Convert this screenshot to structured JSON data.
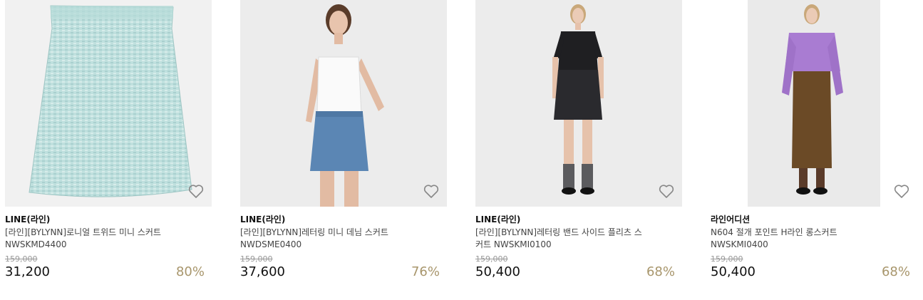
{
  "products": [
    {
      "brand": "LINE(라인)",
      "name": "[라인][BYLYNN]로니얼 트위드 미니 스커트 NWSKMD4400",
      "original_price": "159,000",
      "price": "31,200",
      "discount": "80%",
      "image": "light-mint-tweed-mini-skirt",
      "colors": {
        "bg": "#f1f1f1",
        "garment": "#bfe0de"
      }
    },
    {
      "brand": "LINE(라인)",
      "name": "[라인][BYLYNN]레터링 미니 데님 스커트 NWDSME0400",
      "original_price": "159,000",
      "price": "37,600",
      "discount": "76%",
      "image": "model-white-tank-denim-mini-skirt",
      "colors": {
        "bg": "#ececec",
        "garment": "#5b86b4"
      }
    },
    {
      "brand": "LINE(라인)",
      "name": "[라인][BYLYNN]레터링 밴드 사이드 플리츠 스커트 NWSKMI0100",
      "original_price": "159,000",
      "price": "50,400",
      "discount": "68%",
      "image": "model-black-top-black-pleated-mini-skirt",
      "colors": {
        "bg": "#ececec",
        "garment": "#2a2a2e"
      }
    },
    {
      "brand": "라인어디션",
      "name": "N604 절개 포인트 H라인 롱스커트 NWSKMI0400",
      "original_price": "159,000",
      "price": "50,400",
      "discount": "68%",
      "image": "model-purple-shirt-brown-long-skirt",
      "colors": {
        "bg": "#eaeaea",
        "garment": "#6b4a26"
      }
    }
  ],
  "accent": "#a8966c",
  "icon": "heart-outline-icon"
}
